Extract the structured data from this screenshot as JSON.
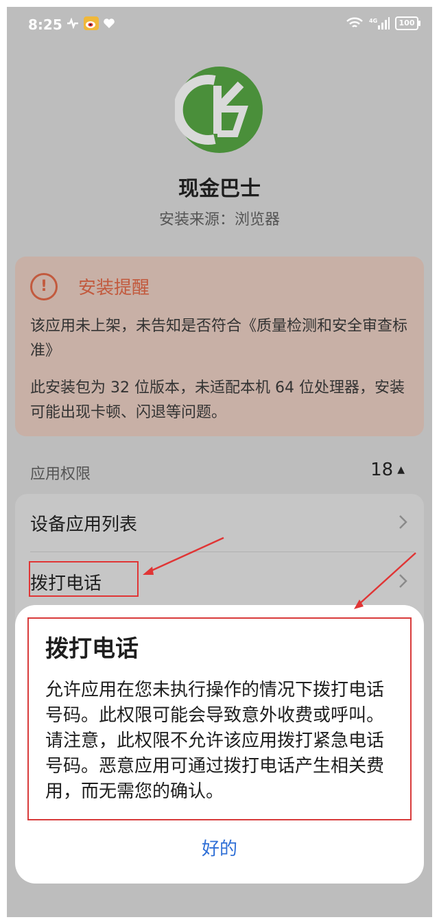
{
  "status_bar": {
    "time": "8:25",
    "battery": "100",
    "network_label": "4G"
  },
  "app": {
    "name": "现金巴士",
    "source": "安装来源：浏览器",
    "brand_color": "#4a8f3a"
  },
  "warning": {
    "title": "安装提醒",
    "paragraph1": "该应用未上架，未告知是否符合《质量检测和安全审查标准》",
    "paragraph2": "此安装包为 32 位版本，未适配本机 64 位处理器，安装可能出现卡顿、闪退等问题。",
    "accent_color": "#c25a3e"
  },
  "permissions": {
    "label": "应用权限",
    "count": "18",
    "items": [
      {
        "label": "设备应用列表"
      },
      {
        "label": "拨打电话"
      }
    ]
  },
  "dialog": {
    "title": "拨打电话",
    "body": "允许应用在您未执行操作的情况下拨打电话号码。此权限可能会导致意外收费或呼叫。请注意，此权限不允许该应用拨打紧急电话号码。恶意应用可通过拨打电话产生相关费用，而无需您的确认。",
    "ok_label": "好的",
    "ok_color": "#2f6fd6"
  },
  "annotation_color": "#e03535"
}
